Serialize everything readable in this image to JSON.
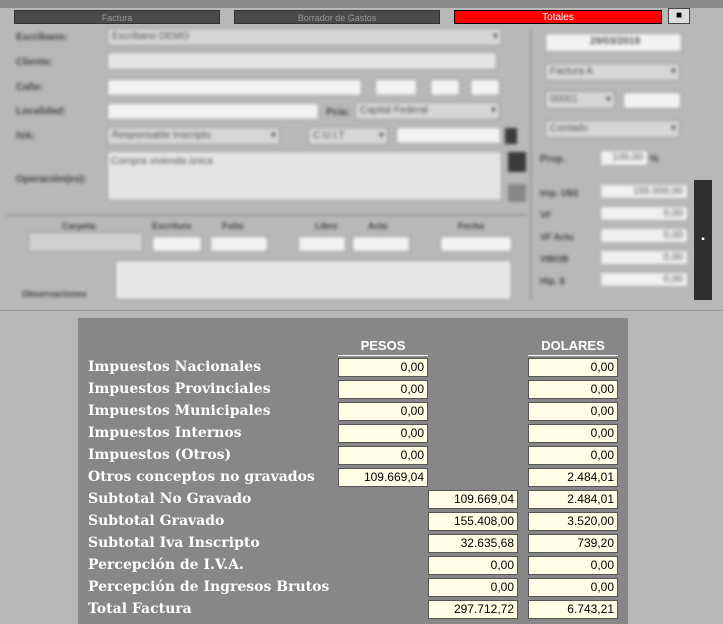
{
  "tabs": [
    {
      "label": "Factura"
    },
    {
      "label": "Borrador de Gastos"
    },
    {
      "label": "Totales"
    }
  ],
  "close_label": "■",
  "form": {
    "escribano_label": "Escribano:",
    "escribano_value": "Escribano DEMO",
    "cliente_label": "Cliente:",
    "calle_label": "Calle:",
    "localidad_label": "Localidad:",
    "pcia_label": "Pcia:",
    "pcia_value": "Capital Federal",
    "iva_label": "IVA:",
    "iva_value": "Responsable Inscripto",
    "cuit_value": "C.U.I.T",
    "operacion_label": "Operación(es):",
    "operacion_value": "Compra vivienda única",
    "date_value": "29/03/2019",
    "factura_type": "Factura A",
    "punto_venta": "00001",
    "condicion": "Contado",
    "prop_label": "Prop.",
    "prop_value": "100,00",
    "prop_unit": "%",
    "carpeta_label": "Carpeta",
    "escritura_label": "Escritura",
    "folio_label": "Folio",
    "libro_label": "Libro",
    "acta_label": "Acta",
    "fecha_label": "Fecha",
    "observaciones_label": "Observaciones",
    "right_fields": [
      {
        "label": "Imp. U$S",
        "value": "155.000,00"
      },
      {
        "label": "VF",
        "value": "0,00"
      },
      {
        "label": "VF Actu",
        "value": "0,00"
      },
      {
        "label": "VIBOB",
        "value": "0,00"
      },
      {
        "label": "Hip. $",
        "value": "0,00"
      }
    ]
  },
  "totals": {
    "pesos_header": "PESOS",
    "dolares_header": "DOLARES",
    "rows": [
      {
        "label": "Impuestos Nacionales",
        "pesos_a": "0,00",
        "pesos_b": "",
        "dolares": "0,00"
      },
      {
        "label": "Impuestos Provinciales",
        "pesos_a": "0,00",
        "pesos_b": "",
        "dolares": "0,00"
      },
      {
        "label": "Impuestos Municipales",
        "pesos_a": "0,00",
        "pesos_b": "",
        "dolares": "0,00"
      },
      {
        "label": "Impuestos Internos",
        "pesos_a": "0,00",
        "pesos_b": "",
        "dolares": "0,00"
      },
      {
        "label": "Impuestos (Otros)",
        "pesos_a": "0,00",
        "pesos_b": "",
        "dolares": "0,00"
      },
      {
        "label": "Otros conceptos no gravados",
        "pesos_a": "109.669,04",
        "pesos_b": "",
        "dolares": "2.484,01"
      },
      {
        "label": "Subtotal No Gravado",
        "pesos_a": "",
        "pesos_b": "109.669,04",
        "dolares": "2.484,01"
      },
      {
        "label": "Subtotal Gravado",
        "pesos_a": "",
        "pesos_b": "155.408,00",
        "dolares": "3.520,00"
      },
      {
        "label": "Subtotal Iva Inscripto",
        "pesos_a": "",
        "pesos_b": "32.635,68",
        "dolares": "739,20"
      },
      {
        "label": "Percepción de I.V.A.",
        "pesos_a": "",
        "pesos_b": "0,00",
        "dolares": "0,00"
      },
      {
        "label": "Percepción de Ingresos Brutos",
        "pesos_a": "",
        "pesos_b": "0,00",
        "dolares": "0,00"
      },
      {
        "label": "Total Factura",
        "pesos_a": "",
        "pesos_b": "297.712,72",
        "dolares": "6.743,21"
      }
    ]
  }
}
